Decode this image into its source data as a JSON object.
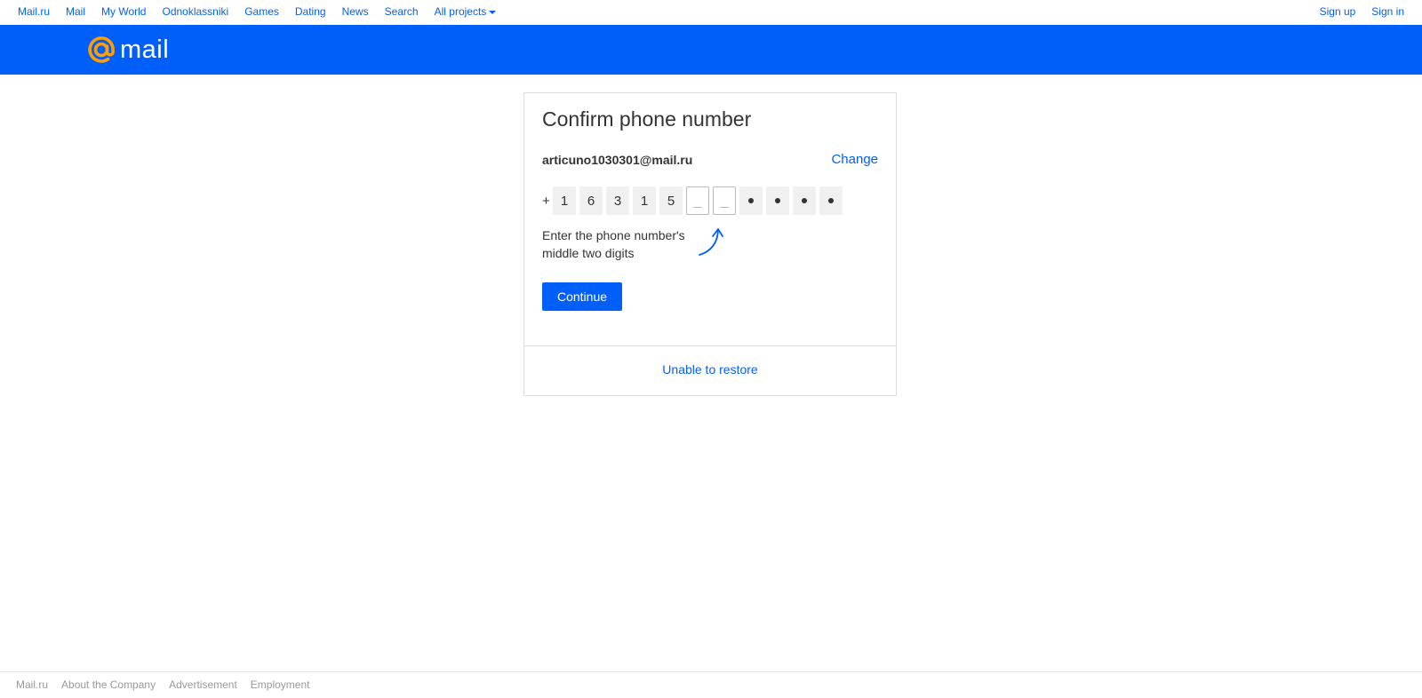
{
  "topnav": {
    "left_links": [
      "Mail.ru",
      "Mail",
      "My World",
      "Odnoklassniki",
      "Games",
      "Dating",
      "News",
      "Search",
      "All projects"
    ],
    "sign_up": "Sign up",
    "sign_in": "Sign in"
  },
  "header": {
    "logo_text": "mail",
    "accent_color": "#005ff9",
    "logo_color": "#ff9e00"
  },
  "card": {
    "title": "Confirm phone number",
    "email": "articuno1030301@mail.ru",
    "change_label": "Change",
    "phone": {
      "prefix": "+",
      "known_digits": [
        "1",
        "6",
        "3",
        "1",
        "5"
      ],
      "input_placeholders": [
        "_",
        "_"
      ],
      "hidden_count": 4
    },
    "hint": "Enter the phone number's middle two digits",
    "continue_label": "Continue",
    "restore_label": "Unable to restore"
  },
  "footer": {
    "links": [
      "Mail.ru",
      "About the Company",
      "Advertisement",
      "Employment"
    ]
  }
}
